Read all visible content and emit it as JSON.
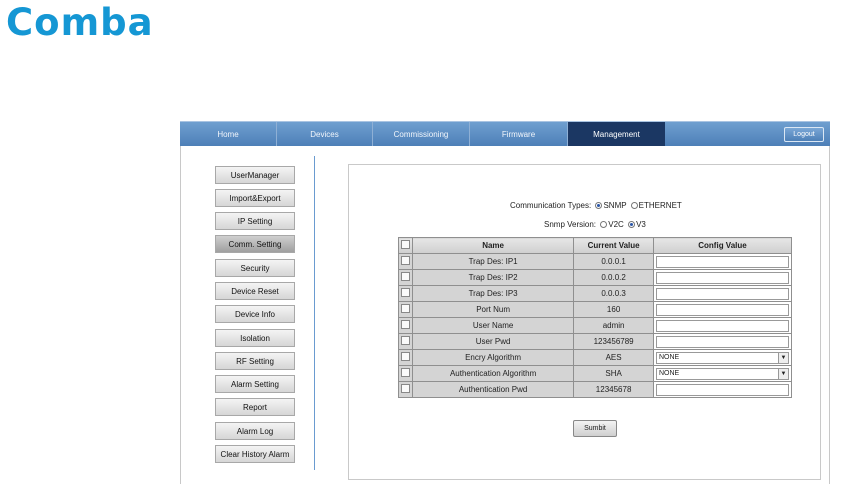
{
  "brand": {
    "logo_text": "Comba",
    "logo_color": "#1597d4"
  },
  "nav": {
    "items": [
      {
        "label": "Home"
      },
      {
        "label": "Devices"
      },
      {
        "label": "Commissioning"
      },
      {
        "label": "Firmware"
      },
      {
        "label": "Management",
        "active": true
      }
    ],
    "logout_label": "Logout"
  },
  "sidebar": {
    "items": [
      {
        "label": "UserManager"
      },
      {
        "label": "Import&Export"
      },
      {
        "label": "IP Setting"
      },
      {
        "label": "Comm. Setting",
        "active": true
      },
      {
        "label": "Security"
      },
      {
        "label": "Device Reset"
      },
      {
        "label": "Device Info"
      },
      {
        "label": "Isolation"
      },
      {
        "label": "RF Setting"
      },
      {
        "label": "Alarm Setting"
      },
      {
        "label": "Report"
      },
      {
        "label": "Alarm Log"
      },
      {
        "label": "Clear History Alarm"
      }
    ]
  },
  "form": {
    "comm_types_label": "Communication Types:",
    "comm_types": [
      {
        "label": "SNMP",
        "selected": true
      },
      {
        "label": "ETHERNET",
        "selected": false
      }
    ],
    "snmp_version_label": "Snmp Version:",
    "snmp_versions": [
      {
        "label": "V2C",
        "selected": false
      },
      {
        "label": "V3",
        "selected": true
      }
    ],
    "table": {
      "headers": {
        "name": "Name",
        "current": "Current Value",
        "config": "Config Value"
      },
      "rows": [
        {
          "name": "Trap Des: IP1",
          "current": "0.0.0.1",
          "config": ""
        },
        {
          "name": "Trap Des: IP2",
          "current": "0.0.0.2",
          "config": ""
        },
        {
          "name": "Trap Des: IP3",
          "current": "0.0.0.3",
          "config": ""
        },
        {
          "name": "Port Num",
          "current": "160",
          "config": ""
        },
        {
          "name": "User Name",
          "current": "admin",
          "config": ""
        },
        {
          "name": "User Pwd",
          "current": "123456789",
          "config": ""
        },
        {
          "name": "Encry Algorithm",
          "current": "AES",
          "config": "NONE",
          "select": true
        },
        {
          "name": "Authentication Algorithm",
          "current": "SHA",
          "config": "NONE",
          "select": true
        },
        {
          "name": "Authentication Pwd",
          "current": "12345678",
          "config": ""
        }
      ]
    },
    "submit_label": "Sumbit"
  }
}
